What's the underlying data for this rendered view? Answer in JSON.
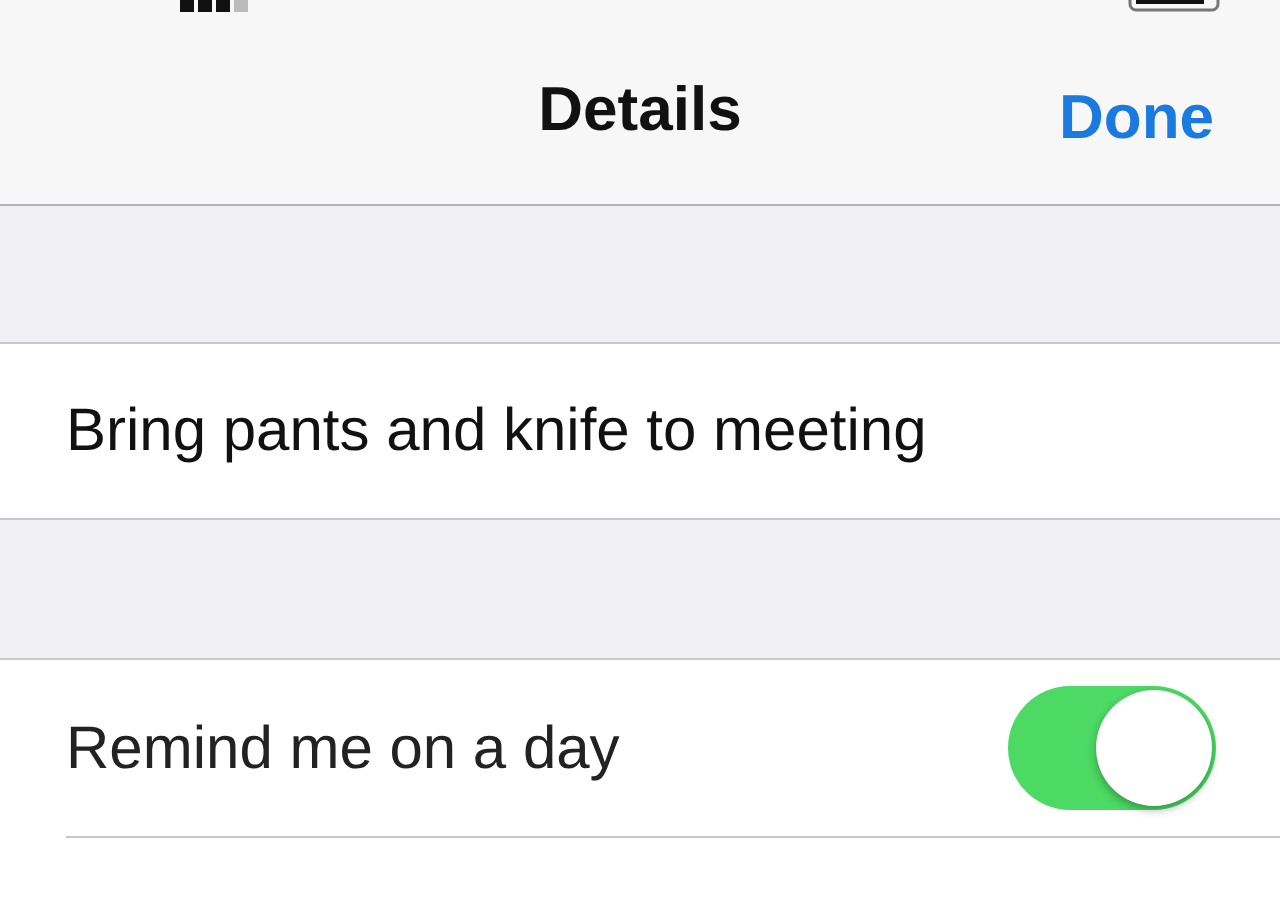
{
  "navigation_bar": {
    "title": "Details",
    "done_button": "Done"
  },
  "reminder": {
    "title": "Bring pants and knife to meeting"
  },
  "settings": [
    {
      "kind": "toggle",
      "label": "Remind me on a day",
      "on": true
    }
  ]
}
